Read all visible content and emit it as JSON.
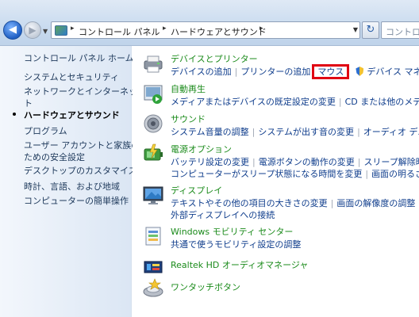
{
  "address": {
    "segments": [
      "コントロール パネル",
      "ハードウェアとサウンド"
    ],
    "search_placeholder": "コントロ"
  },
  "sidebar": {
    "items": [
      "コントロール パネル ホーム",
      "システムとセキュリティ",
      "ネットワークとインターネット",
      "ハードウェアとサウンド",
      "プログラム",
      "ユーザー アカウントと家族の安全設定",
      "デスクトップのカスタマイズ",
      "時計、言語、および地域",
      "コンピューターの簡単操作"
    ],
    "items_wrapped": {
      "network_line1": "ネットワークとインターネッ",
      "network_line2": "ト",
      "user_line1": "ユーザー アカウントと家族の",
      "user_line2": "ための安全設定"
    }
  },
  "categories": {
    "devices": {
      "title": "デバイスとプリンター",
      "links": [
        "デバイスの追加",
        "プリンターの追加",
        "マウス",
        "デバイス マネー"
      ]
    },
    "autoplay": {
      "title": "自動再生",
      "links": [
        "メディアまたはデバイスの既定設定の変更",
        "CD または他のメディアの"
      ]
    },
    "sound": {
      "title": "サウンド",
      "links": [
        "システム音量の調整",
        "システムが出す音の変更",
        "オーディオ デバイス"
      ]
    },
    "power": {
      "title": "電源オプション",
      "links_row1": [
        "バッテリ設定の変更",
        "電源ボタンの動作の変更",
        "スリープ解除時のパ"
      ],
      "links_row2": [
        "コンピューターがスリープ状態になる時間を変更",
        "画面の明るさの調整"
      ]
    },
    "display": {
      "title": "ディスプレイ",
      "links_row1": [
        "テキストやその他の項目の大きさの変更",
        "画面の解像度の調整",
        "プロ"
      ],
      "links_row2": [
        "外部ディスプレイへの接続"
      ]
    },
    "mobility": {
      "title": "Windows モビリティ センター",
      "links": [
        "共通で使うモビリティ設定の調整"
      ]
    },
    "realtek": {
      "title": "Realtek HD オーディオマネージャ"
    },
    "onetouch": {
      "title": "ワンタッチボタン"
    }
  },
  "colors": {
    "highlight_box": "#e00012",
    "category_title": "#1b8b1b",
    "link": "#0f3d8c"
  }
}
